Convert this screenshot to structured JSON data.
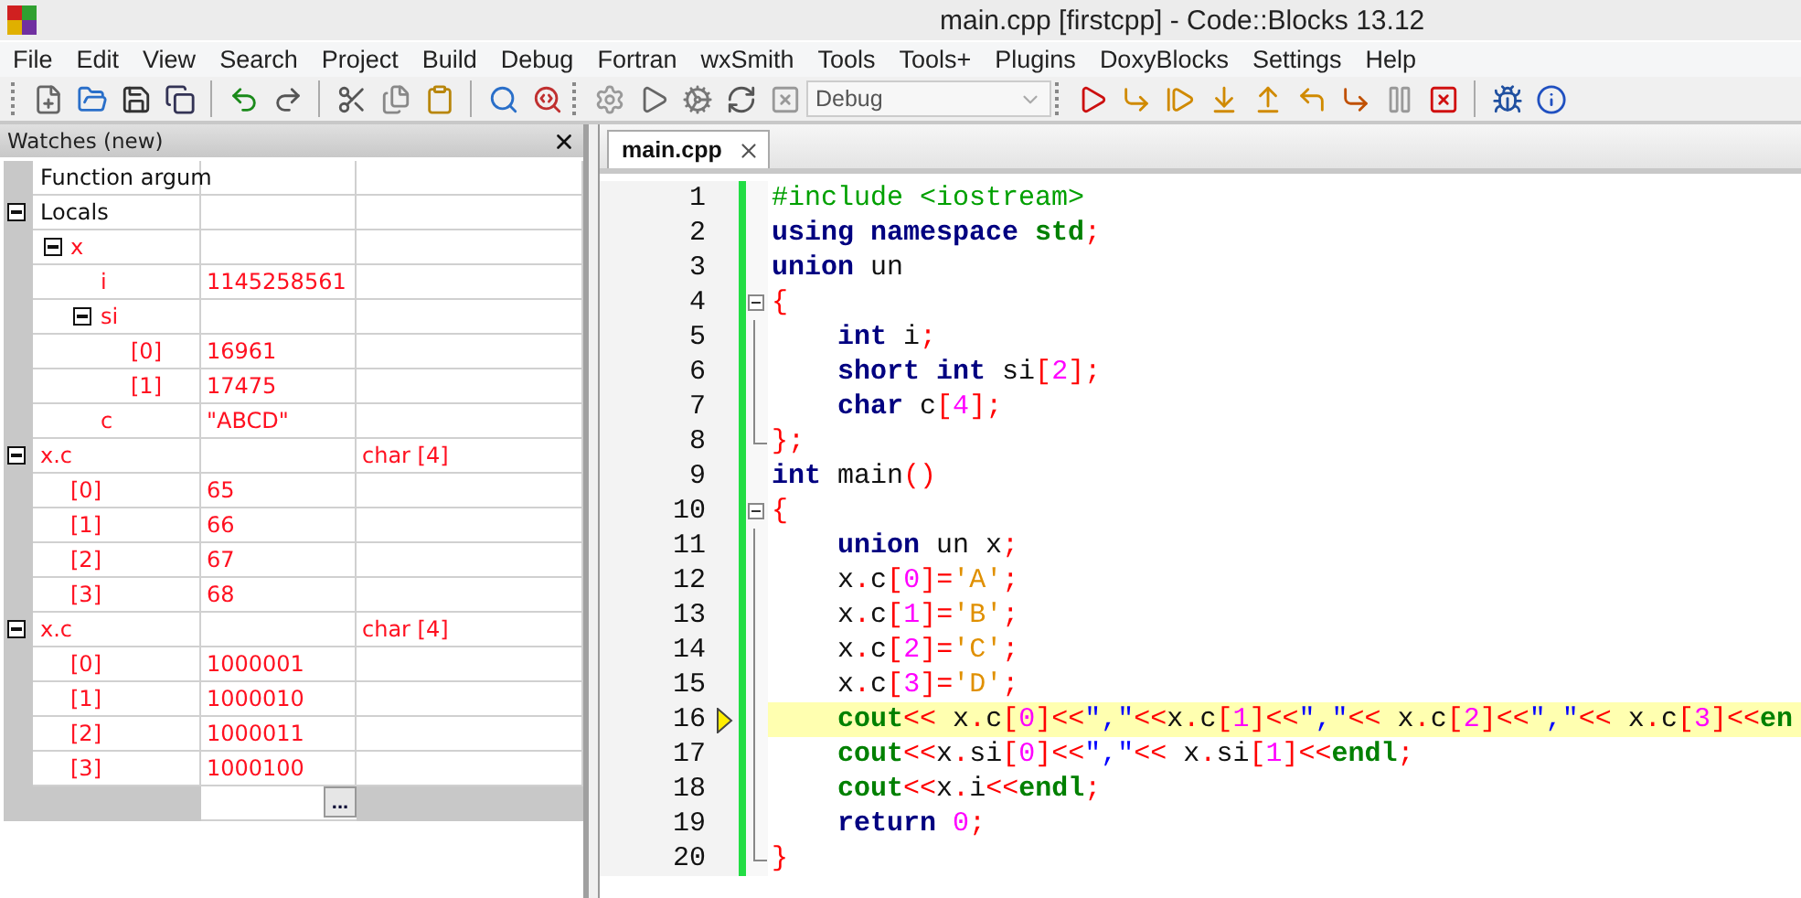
{
  "window": {
    "title": "main.cpp [firstcpp] - Code::Blocks 13.12"
  },
  "menu": [
    "File",
    "Edit",
    "View",
    "Search",
    "Project",
    "Build",
    "Debug",
    "Fortran",
    "wxSmith",
    "Tools",
    "Tools+",
    "Plugins",
    "DoxyBlocks",
    "Settings",
    "Help"
  ],
  "toolbar": {
    "build_target": "Debug"
  },
  "watches": {
    "title": "Watches (new)",
    "edit_button": "...",
    "items": [
      {
        "name": "Function argum",
        "changed": false
      },
      {
        "name": "Locals",
        "changed": false,
        "expanded": true,
        "children": [
          {
            "name": "x",
            "changed": true,
            "expanded": true,
            "children": [
              {
                "name": "i",
                "value": "1145258561",
                "changed": true
              },
              {
                "name": "si",
                "changed": true,
                "expanded": true,
                "children": [
                  {
                    "name": "[0]",
                    "value": "16961",
                    "changed": true
                  },
                  {
                    "name": "[1]",
                    "value": "17475",
                    "changed": true
                  }
                ]
              },
              {
                "name": "c",
                "value": "\"ABCD\"",
                "changed": true
              }
            ]
          }
        ]
      },
      {
        "name": "x.c",
        "type": "char [4]",
        "changed": true,
        "expanded": true,
        "children": [
          {
            "name": "[0]",
            "value": "65",
            "changed": true
          },
          {
            "name": "[1]",
            "value": "66",
            "changed": true
          },
          {
            "name": "[2]",
            "value": "67",
            "changed": true
          },
          {
            "name": "[3]",
            "value": "68",
            "changed": true
          }
        ]
      },
      {
        "name": "x.c",
        "type": "char [4]",
        "changed": true,
        "expanded": true,
        "children": [
          {
            "name": "[0]",
            "value": "1000001",
            "changed": true
          },
          {
            "name": "[1]",
            "value": "1000010",
            "changed": true
          },
          {
            "name": "[2]",
            "value": "1000011",
            "changed": true
          },
          {
            "name": "[3]",
            "value": "1000100",
            "changed": true
          }
        ]
      }
    ]
  },
  "editor": {
    "tabs": [
      {
        "label": "main.cpp",
        "selected": true
      }
    ],
    "lines": [
      {
        "number": "1",
        "kind": "plain",
        "current": false,
        "tokens": [
          {
            "kind": "pp",
            "text": "#include <iostream>"
          }
        ]
      },
      {
        "number": "2",
        "kind": "plain",
        "current": false,
        "tokens": [
          {
            "kind": "kw",
            "text": "using"
          },
          {
            "kind": "kw",
            "text": " namespace"
          },
          {
            "kind": "lib",
            "text": " std"
          },
          {
            "kind": "op",
            "text": ";"
          }
        ]
      },
      {
        "number": "3",
        "kind": "plain",
        "current": false,
        "tokens": [
          {
            "kind": "kw",
            "text": "union"
          },
          {
            "kind": "plain",
            "text": " un"
          }
        ]
      },
      {
        "number": "4",
        "kind": "fold_start",
        "current": false,
        "tokens": [
          {
            "kind": "op",
            "text": "{"
          }
        ]
      },
      {
        "number": "5",
        "kind": "fold_body",
        "current": false,
        "tokens": [
          {
            "kind": "kw",
            "text": "    int"
          },
          {
            "kind": "plain",
            "text": " i"
          },
          {
            "kind": "op",
            "text": ";"
          }
        ]
      },
      {
        "number": "6",
        "kind": "fold_body",
        "current": false,
        "tokens": [
          {
            "kind": "kw",
            "text": "    short"
          },
          {
            "kind": "kw",
            "text": " int"
          },
          {
            "kind": "plain",
            "text": " si"
          },
          {
            "kind": "op",
            "text": "["
          },
          {
            "kind": "num",
            "text": "2"
          },
          {
            "kind": "op",
            "text": "];"
          }
        ]
      },
      {
        "number": "7",
        "kind": "fold_body",
        "current": false,
        "tokens": [
          {
            "kind": "kw",
            "text": "    char"
          },
          {
            "kind": "plain",
            "text": " c"
          },
          {
            "kind": "op",
            "text": "["
          },
          {
            "kind": "num",
            "text": "4"
          },
          {
            "kind": "op",
            "text": "];"
          }
        ]
      },
      {
        "number": "8",
        "kind": "fold_end",
        "current": false,
        "tokens": [
          {
            "kind": "op",
            "text": "};"
          }
        ]
      },
      {
        "number": "9",
        "kind": "plain",
        "current": false,
        "tokens": [
          {
            "kind": "kw",
            "text": "int"
          },
          {
            "kind": "plain",
            "text": " main"
          },
          {
            "kind": "op",
            "text": "()"
          }
        ]
      },
      {
        "number": "10",
        "kind": "fold_start",
        "current": false,
        "tokens": [
          {
            "kind": "op",
            "text": "{"
          }
        ]
      },
      {
        "number": "11",
        "kind": "fold_body",
        "current": false,
        "tokens": [
          {
            "kind": "kw",
            "text": "    union"
          },
          {
            "kind": "plain",
            "text": " un x"
          },
          {
            "kind": "op",
            "text": ";"
          }
        ]
      },
      {
        "number": "12",
        "kind": "fold_body",
        "current": false,
        "tokens": [
          {
            "kind": "plain",
            "text": "    x"
          },
          {
            "kind": "op",
            "text": "."
          },
          {
            "kind": "plain",
            "text": "c"
          },
          {
            "kind": "op",
            "text": "["
          },
          {
            "kind": "num",
            "text": "0"
          },
          {
            "kind": "op",
            "text": "]="
          },
          {
            "kind": "chr",
            "text": "'A'"
          },
          {
            "kind": "op",
            "text": ";"
          }
        ]
      },
      {
        "number": "13",
        "kind": "fold_body",
        "current": false,
        "tokens": [
          {
            "kind": "plain",
            "text": "    x"
          },
          {
            "kind": "op",
            "text": "."
          },
          {
            "kind": "plain",
            "text": "c"
          },
          {
            "kind": "op",
            "text": "["
          },
          {
            "kind": "num",
            "text": "1"
          },
          {
            "kind": "op",
            "text": "]="
          },
          {
            "kind": "chr",
            "text": "'B'"
          },
          {
            "kind": "op",
            "text": ";"
          }
        ]
      },
      {
        "number": "14",
        "kind": "fold_body",
        "current": false,
        "tokens": [
          {
            "kind": "plain",
            "text": "    x"
          },
          {
            "kind": "op",
            "text": "."
          },
          {
            "kind": "plain",
            "text": "c"
          },
          {
            "kind": "op",
            "text": "["
          },
          {
            "kind": "num",
            "text": "2"
          },
          {
            "kind": "op",
            "text": "]="
          },
          {
            "kind": "chr",
            "text": "'C'"
          },
          {
            "kind": "op",
            "text": ";"
          }
        ]
      },
      {
        "number": "15",
        "kind": "fold_body",
        "current": false,
        "tokens": [
          {
            "kind": "plain",
            "text": "    x"
          },
          {
            "kind": "op",
            "text": "."
          },
          {
            "kind": "plain",
            "text": "c"
          },
          {
            "kind": "op",
            "text": "["
          },
          {
            "kind": "num",
            "text": "3"
          },
          {
            "kind": "op",
            "text": "]="
          },
          {
            "kind": "chr",
            "text": "'D'"
          },
          {
            "kind": "op",
            "text": ";"
          }
        ]
      },
      {
        "number": "16",
        "kind": "fold_body",
        "current": true,
        "tokens": [
          {
            "kind": "lib",
            "text": "    cout"
          },
          {
            "kind": "op",
            "text": "<<"
          },
          {
            "kind": "plain",
            "text": " x"
          },
          {
            "kind": "op",
            "text": "."
          },
          {
            "kind": "plain",
            "text": "c"
          },
          {
            "kind": "op",
            "text": "["
          },
          {
            "kind": "num",
            "text": "0"
          },
          {
            "kind": "op",
            "text": "]<<"
          },
          {
            "kind": "str",
            "text": "\",\""
          },
          {
            "kind": "op",
            "text": "<<"
          },
          {
            "kind": "plain",
            "text": "x"
          },
          {
            "kind": "op",
            "text": "."
          },
          {
            "kind": "plain",
            "text": "c"
          },
          {
            "kind": "op",
            "text": "["
          },
          {
            "kind": "num",
            "text": "1"
          },
          {
            "kind": "op",
            "text": "]<<"
          },
          {
            "kind": "str",
            "text": "\",\""
          },
          {
            "kind": "op",
            "text": "<<"
          },
          {
            "kind": "plain",
            "text": " x"
          },
          {
            "kind": "op",
            "text": "."
          },
          {
            "kind": "plain",
            "text": "c"
          },
          {
            "kind": "op",
            "text": "["
          },
          {
            "kind": "num",
            "text": "2"
          },
          {
            "kind": "op",
            "text": "]<<"
          },
          {
            "kind": "str",
            "text": "\",\""
          },
          {
            "kind": "op",
            "text": "<<"
          },
          {
            "kind": "plain",
            "text": " x"
          },
          {
            "kind": "op",
            "text": "."
          },
          {
            "kind": "plain",
            "text": "c"
          },
          {
            "kind": "op",
            "text": "["
          },
          {
            "kind": "num",
            "text": "3"
          },
          {
            "kind": "op",
            "text": "]<<"
          },
          {
            "kind": "lib",
            "text": "en"
          }
        ]
      },
      {
        "number": "17",
        "kind": "fold_body",
        "current": false,
        "tokens": [
          {
            "kind": "lib",
            "text": "    cout"
          },
          {
            "kind": "op",
            "text": "<<"
          },
          {
            "kind": "plain",
            "text": "x"
          },
          {
            "kind": "op",
            "text": "."
          },
          {
            "kind": "plain",
            "text": "si"
          },
          {
            "kind": "op",
            "text": "["
          },
          {
            "kind": "num",
            "text": "0"
          },
          {
            "kind": "op",
            "text": "]<<"
          },
          {
            "kind": "str",
            "text": "\",\""
          },
          {
            "kind": "op",
            "text": "<<"
          },
          {
            "kind": "plain",
            "text": " x"
          },
          {
            "kind": "op",
            "text": "."
          },
          {
            "kind": "plain",
            "text": "si"
          },
          {
            "kind": "op",
            "text": "["
          },
          {
            "kind": "num",
            "text": "1"
          },
          {
            "kind": "op",
            "text": "]<<"
          },
          {
            "kind": "lib",
            "text": "endl"
          },
          {
            "kind": "op",
            "text": ";"
          }
        ]
      },
      {
        "number": "18",
        "kind": "fold_body",
        "current": false,
        "tokens": [
          {
            "kind": "lib",
            "text": "    cout"
          },
          {
            "kind": "op",
            "text": "<<"
          },
          {
            "kind": "plain",
            "text": "x"
          },
          {
            "kind": "op",
            "text": "."
          },
          {
            "kind": "plain",
            "text": "i"
          },
          {
            "kind": "op",
            "text": "<<"
          },
          {
            "kind": "lib",
            "text": "endl"
          },
          {
            "kind": "op",
            "text": ";"
          }
        ]
      },
      {
        "number": "19",
        "kind": "fold_body",
        "current": false,
        "tokens": [
          {
            "kind": "kw",
            "text": "    return"
          },
          {
            "kind": "num",
            "text": " 0"
          },
          {
            "kind": "op",
            "text": ";"
          }
        ]
      },
      {
        "number": "20",
        "kind": "fold_end",
        "current": false,
        "tokens": [
          {
            "kind": "op",
            "text": "}"
          }
        ]
      }
    ]
  }
}
